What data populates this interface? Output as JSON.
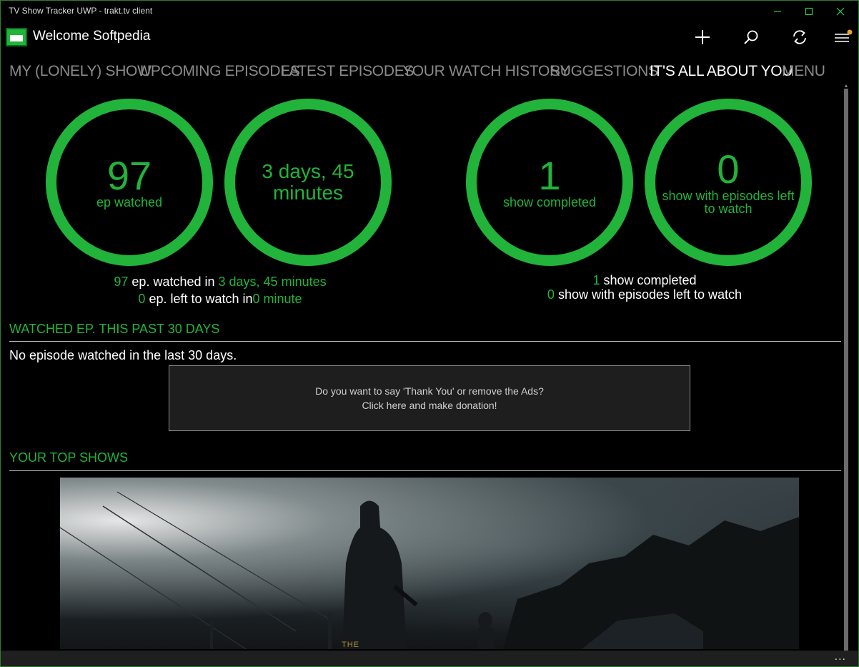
{
  "window": {
    "title": "TV Show Tracker UWP - trakt.tv client"
  },
  "header": {
    "welcome": "Welcome Softpedia"
  },
  "nav": {
    "tabs": [
      {
        "label": "MY (LONELY) SHOW"
      },
      {
        "label": "UPCOMING EPISODES"
      },
      {
        "label": "LATEST EPISODES"
      },
      {
        "label": "YOUR WATCH HISTORY"
      },
      {
        "label": "SUGGESTIONS"
      },
      {
        "label": "IT'S ALL ABOUT YOU"
      },
      {
        "label": "MENU"
      }
    ]
  },
  "stats": {
    "ep_watched": {
      "value": "97",
      "label": "ep watched"
    },
    "time_watched": {
      "line1": "3 days, 45",
      "line2": "minutes"
    },
    "shows_completed": {
      "value": "1",
      "label": "show completed"
    },
    "shows_left": {
      "value": "0",
      "label_line1": "show with episodes left",
      "label_line2": "to watch"
    }
  },
  "summary_left": {
    "line1_count": "97",
    "line1_text": " ep. watched in ",
    "line1_time": "3 days, 45 minutes",
    "line2_count": "0",
    "line2_text": " ep. left to watch in",
    "line2_time": "0 minute"
  },
  "summary_right": {
    "line1_count": "1",
    "line1_text": " show completed",
    "line2_count": "0",
    "line2_text": " show with episodes left to watch"
  },
  "watched_section": {
    "title": "WATCHED EP. THIS PAST 30 DAYS",
    "empty_text": "No episode watched in the last 30 days."
  },
  "donation": {
    "line1": "Do you want to say 'Thank You' or remove the Ads?",
    "line2": "Click here and make donation!"
  },
  "top_shows": {
    "title": "YOUR TOP SHOWS",
    "poster_caption": "THE"
  },
  "bottom": {
    "more": "..."
  },
  "colors": {
    "accent": "#22b33a",
    "background": "#000000"
  }
}
